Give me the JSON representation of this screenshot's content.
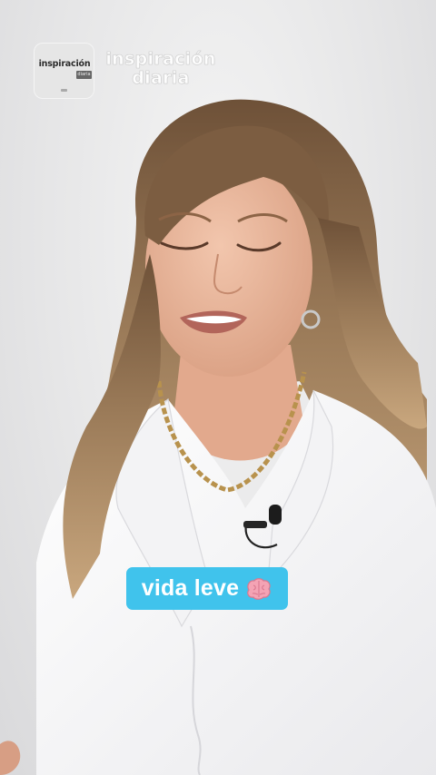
{
  "brand": {
    "logo_word": "inspiración",
    "logo_tag": "diaria",
    "name_line1": "inspiración",
    "name_line2": "diaria"
  },
  "caption": {
    "text": "vida leve",
    "icon": "brain-icon"
  },
  "colors": {
    "caption_bg": "#40c3ec",
    "caption_text": "#ffffff",
    "background": "#e9e9ea",
    "shirt": "#f7f7f7",
    "hair": "#8a6a4c",
    "skin": "#e8b59b"
  }
}
